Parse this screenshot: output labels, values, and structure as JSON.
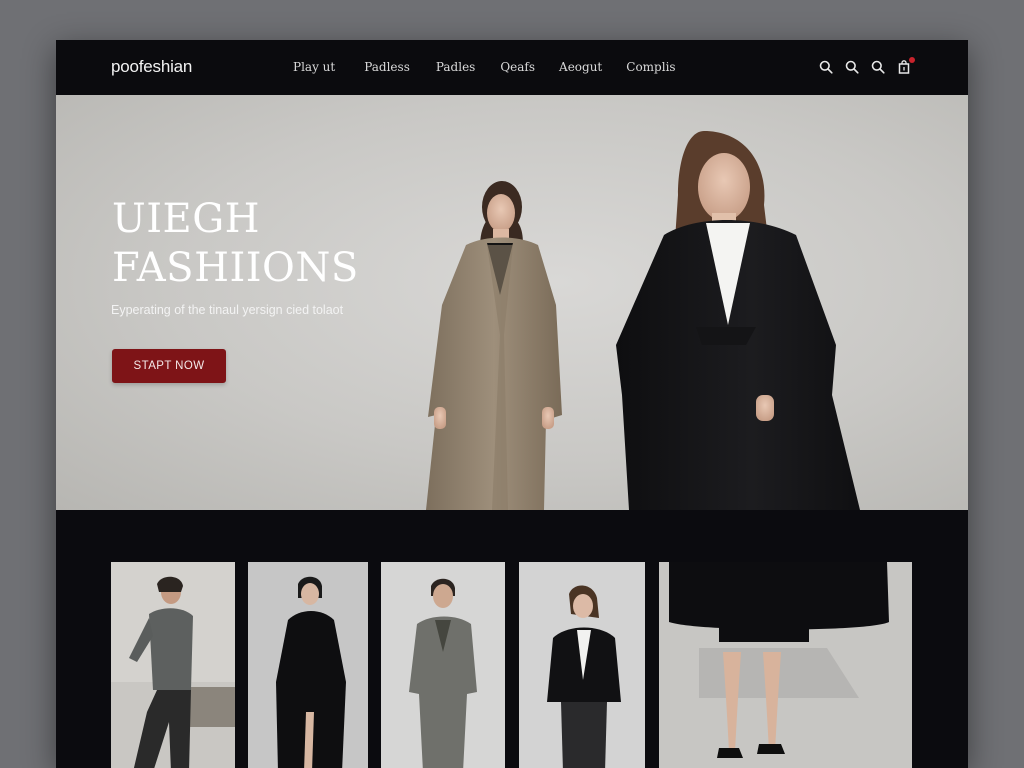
{
  "nav": {
    "logo": "poofeshian",
    "links": [
      "Play ut",
      "Padless",
      "Padles",
      "Qeafs",
      "Aeogut",
      "Complis"
    ]
  },
  "icons": [
    "search-icon",
    "search-icon",
    "search-icon",
    "cart-icon"
  ],
  "hero": {
    "title_line1": "UIEGH",
    "title_line2": "FASHIIONS",
    "subtitle": "Eyperating of the tinaul yersign cied tolaot",
    "cta_label": "STAPT NOW"
  },
  "colors": {
    "nav_bg": "#0b0b0e",
    "hero_bg": "#d0cfcc",
    "accent": "#7e1417",
    "cart_badge": "#c8232c",
    "band_bg": "#0b0b0f"
  },
  "gallery": {
    "tiles": [
      "model-grey-sweater",
      "model-black-coat",
      "model-grey-suit",
      "model-black-jacket",
      "model-black-skirt-heels"
    ]
  }
}
